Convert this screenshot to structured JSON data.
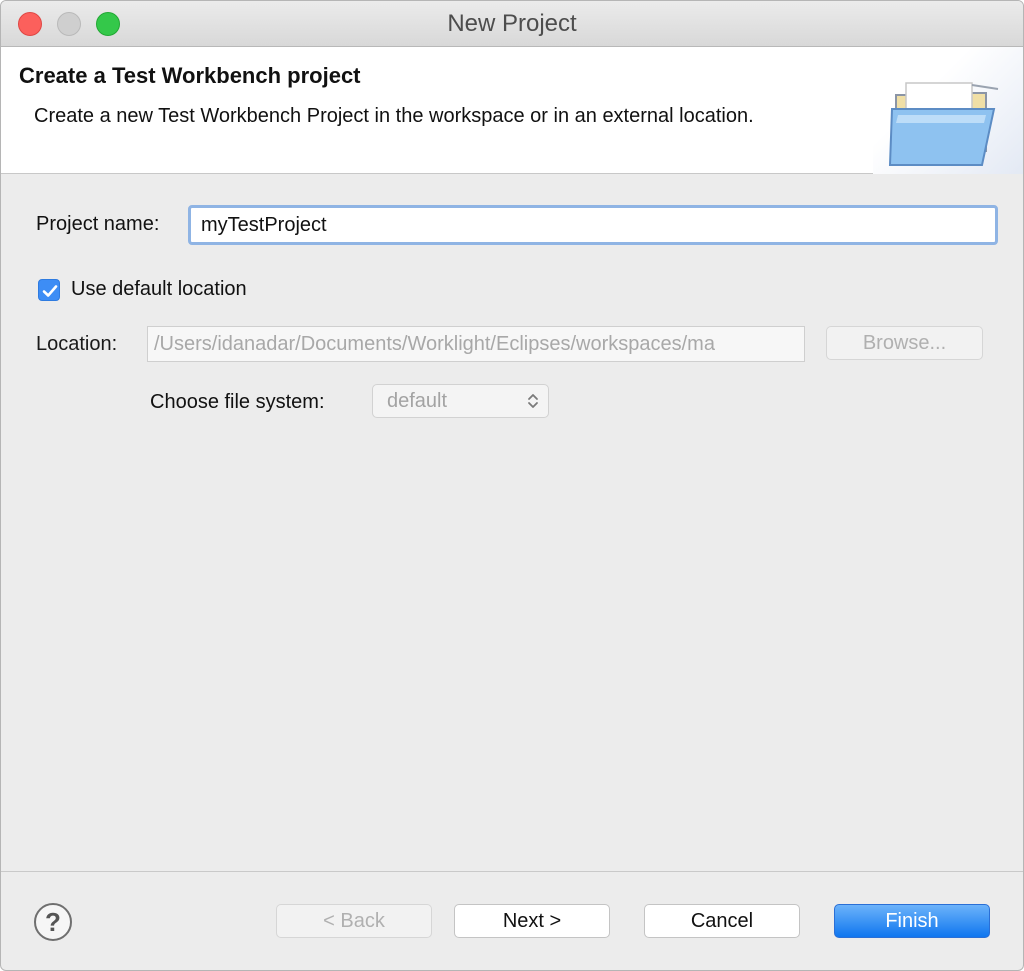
{
  "window": {
    "title": "New Project"
  },
  "banner": {
    "title": "Create a Test Workbench project",
    "description": "Create a new Test Workbench Project in the workspace or in an external location.",
    "icon": "open-folder-icon"
  },
  "form": {
    "project_name_label": "Project name:",
    "project_name_value": "myTestProject",
    "use_default_location_label": "Use default location",
    "use_default_location_checked": true,
    "location_label": "Location:",
    "location_value": "/Users/idanadar/Documents/Worklight/Eclipses/workspaces/ma",
    "browse_label": "Browse...",
    "file_system_label": "Choose file system:",
    "file_system_value": "default"
  },
  "footer": {
    "help_icon": "?",
    "back_label": "< Back",
    "next_label": "Next >",
    "cancel_label": "Cancel",
    "finish_label": "Finish"
  },
  "colors": {
    "accent": "#1a7ff0",
    "focus_ring": "#8fb4e4",
    "close": "#fc605c",
    "zoom": "#34c84a"
  }
}
